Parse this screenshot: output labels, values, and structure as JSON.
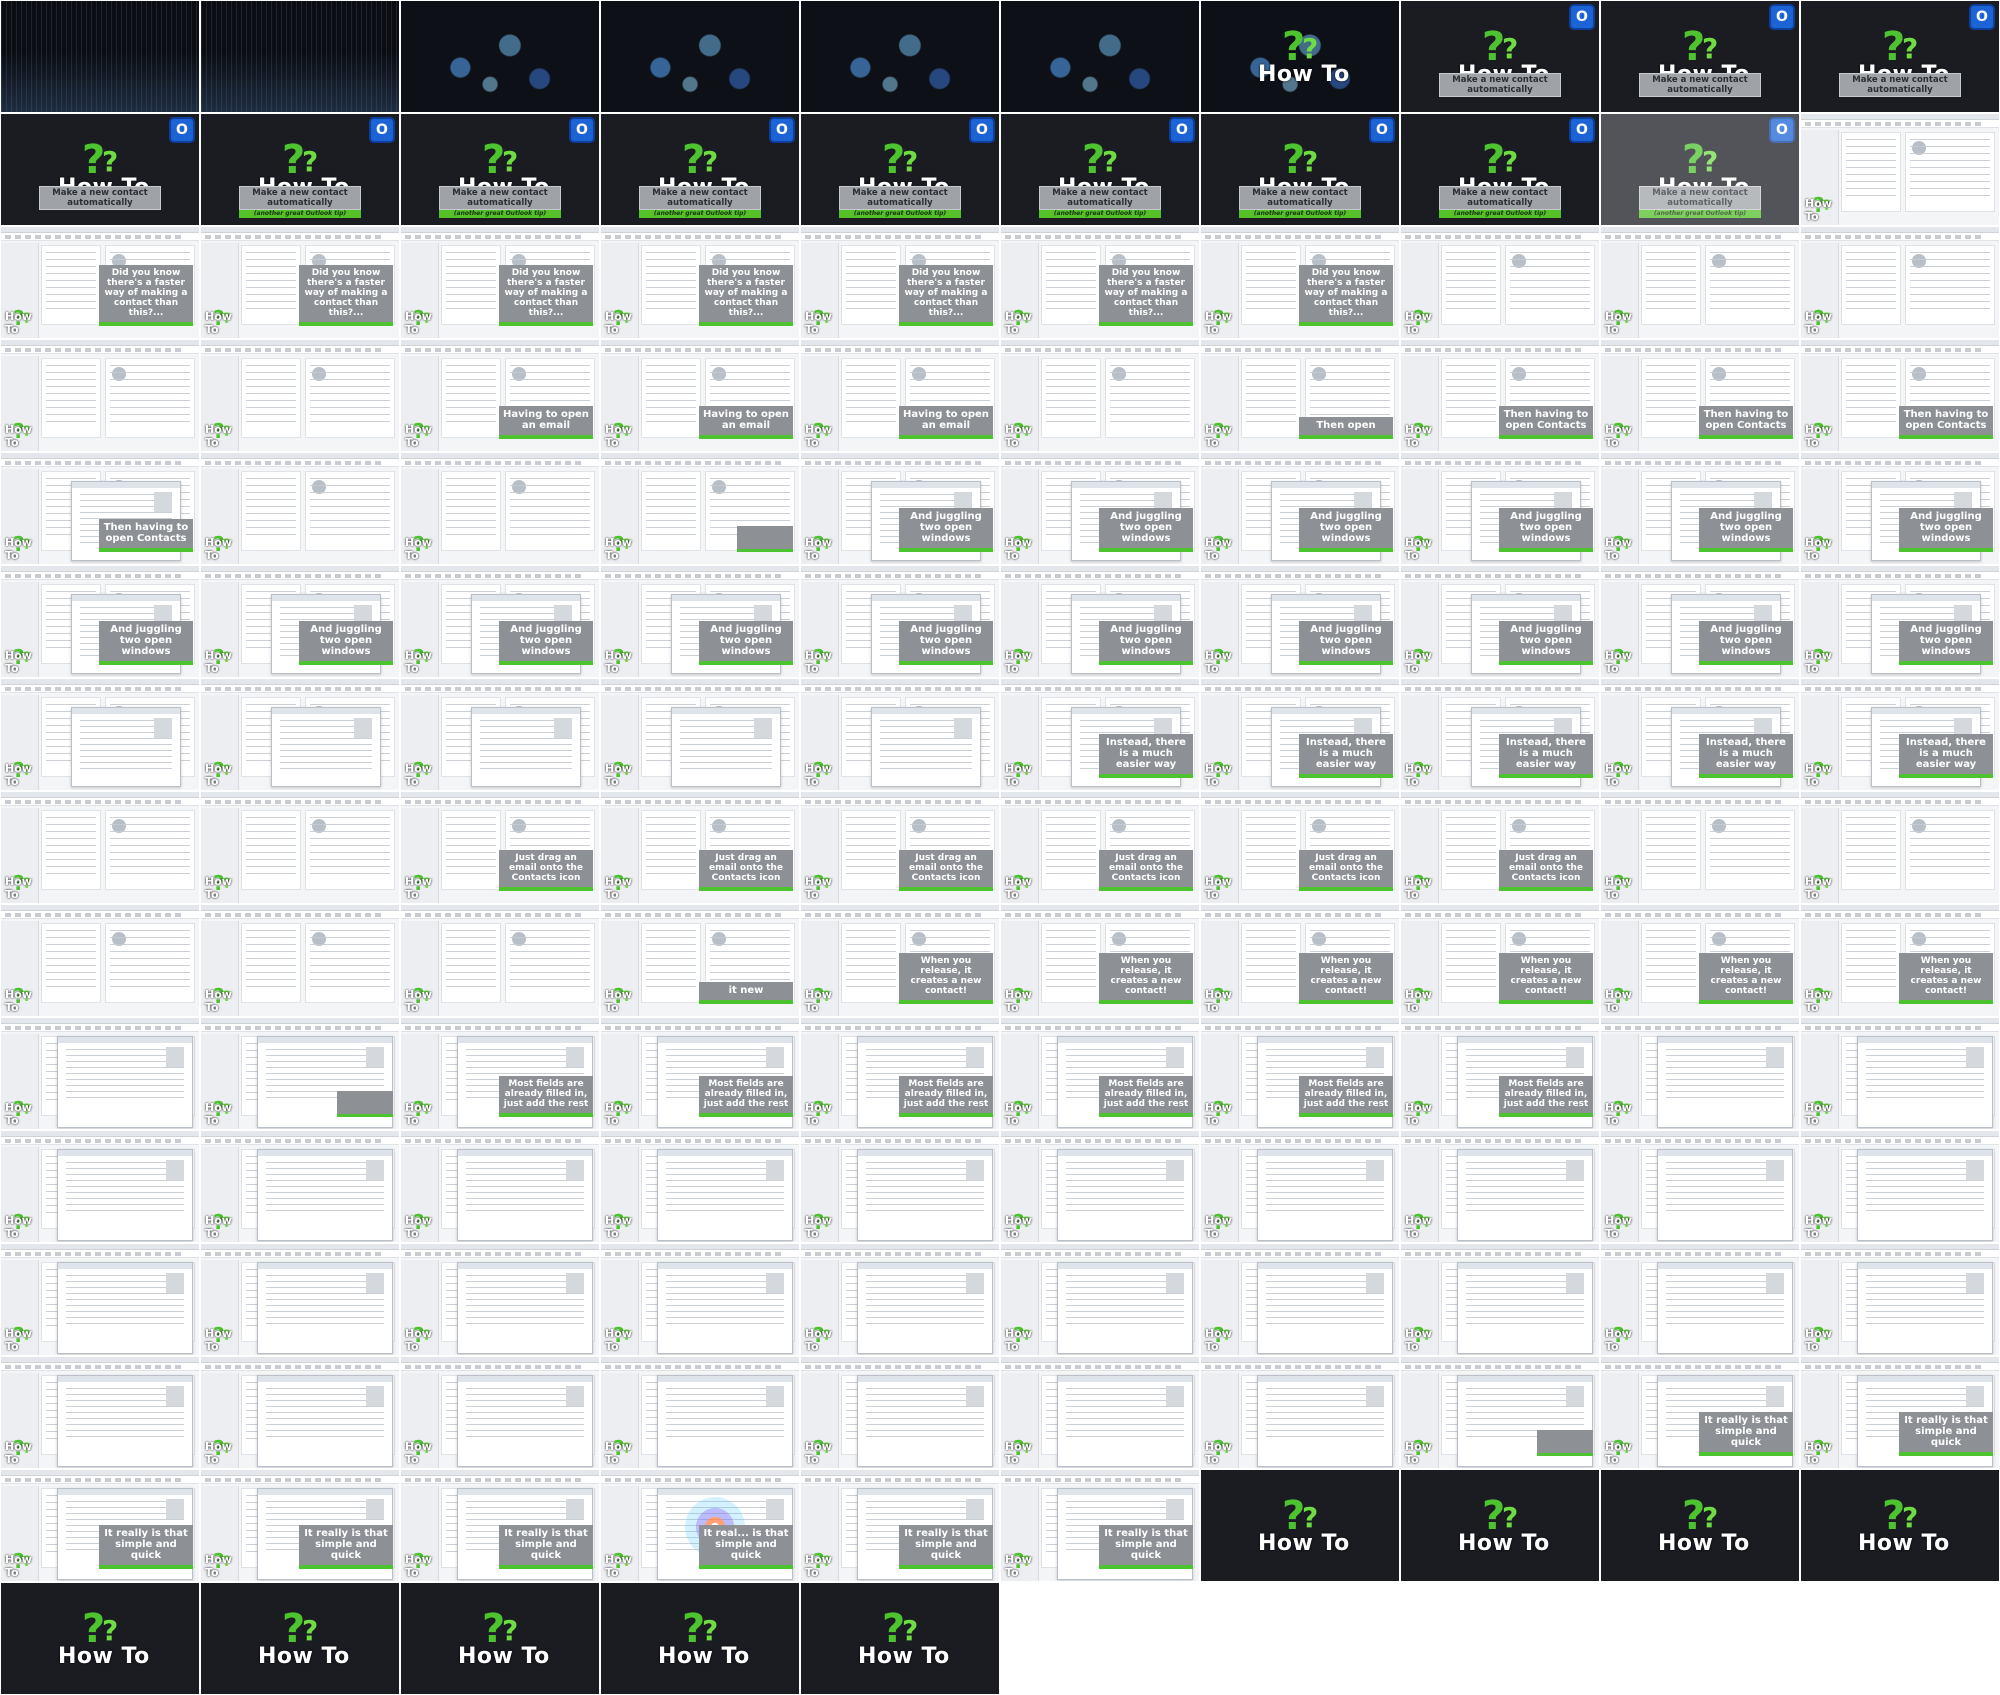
{
  "title": {
    "how_to": "How To",
    "make": "Make a new contact automatically",
    "another": "(another great Outlook tip)",
    "outlook_letter": "O"
  },
  "captions": {
    "c1": "Did you know there's a faster way of making a contact than this?...",
    "c2": "Having to open an email",
    "c3a": "Then open",
    "c3": "Then having to open Contacts",
    "c4": "And juggling two open windows",
    "c5": "Instead, there is a much easier way",
    "c6": "Just drag an email onto the Contacts icon",
    "c6b": "it new",
    "c7": "When you release, it creates a new contact!",
    "c8": "Most fields are already filled in, just add the rest",
    "c9": "It really is that simple and quick",
    "c9b": "It real... is that simple and quick"
  },
  "tiles": [
    {
      "k": "grid"
    },
    {
      "k": "grid"
    },
    {
      "k": "particles"
    },
    {
      "k": "particles"
    },
    {
      "k": "particles"
    },
    {
      "k": "particles"
    },
    {
      "k": "ht3d"
    },
    {
      "k": "title"
    },
    {
      "k": "title"
    },
    {
      "k": "title"
    },
    {
      "k": "title"
    },
    {
      "k": "title2"
    },
    {
      "k": "title2"
    },
    {
      "k": "title2"
    },
    {
      "k": "title2"
    },
    {
      "k": "title2"
    },
    {
      "k": "title2"
    },
    {
      "k": "title2"
    },
    {
      "k": "titlefade"
    },
    {
      "k": "ui",
      "v": "list"
    },
    {
      "k": "ui",
      "v": "list",
      "cap": "c1"
    },
    {
      "k": "ui",
      "v": "list",
      "cap": "c1"
    },
    {
      "k": "ui",
      "v": "list",
      "cap": "c1"
    },
    {
      "k": "ui",
      "v": "list",
      "cap": "c1"
    },
    {
      "k": "ui",
      "v": "list",
      "cap": "c1"
    },
    {
      "k": "ui",
      "v": "list",
      "cap": "c1"
    },
    {
      "k": "ui",
      "v": "list",
      "cap": "c1"
    },
    {
      "k": "ui",
      "v": "list"
    },
    {
      "k": "ui",
      "v": "list"
    },
    {
      "k": "ui",
      "v": "list"
    },
    {
      "k": "ui",
      "v": "list"
    },
    {
      "k": "ui",
      "v": "read"
    },
    {
      "k": "ui",
      "v": "read",
      "cap": "c2"
    },
    {
      "k": "ui",
      "v": "read",
      "cap": "c2"
    },
    {
      "k": "ui",
      "v": "read",
      "cap": "c2"
    },
    {
      "k": "ui",
      "v": "read"
    },
    {
      "k": "ui",
      "v": "read",
      "cap": "c3a"
    },
    {
      "k": "ui",
      "v": "read",
      "cap": "c3"
    },
    {
      "k": "ui",
      "v": "read",
      "cap": "c3"
    },
    {
      "k": "ui",
      "v": "read",
      "cap": "c3"
    },
    {
      "k": "ui",
      "v": "win",
      "cap": "c3"
    },
    {
      "k": "ui",
      "v": "read"
    },
    {
      "k": "ui",
      "v": "list"
    },
    {
      "k": "ui",
      "v": "list",
      "gray": true
    },
    {
      "k": "ui",
      "v": "win",
      "cap": "c4"
    },
    {
      "k": "ui",
      "v": "win",
      "cap": "c4"
    },
    {
      "k": "ui",
      "v": "win",
      "cap": "c4"
    },
    {
      "k": "ui",
      "v": "win",
      "cap": "c4"
    },
    {
      "k": "ui",
      "v": "win",
      "cap": "c4"
    },
    {
      "k": "ui",
      "v": "win",
      "cap": "c4"
    },
    {
      "k": "ui",
      "v": "win",
      "cap": "c4"
    },
    {
      "k": "ui",
      "v": "win",
      "cap": "c4"
    },
    {
      "k": "ui",
      "v": "win",
      "cap": "c4"
    },
    {
      "k": "ui",
      "v": "win",
      "cap": "c4"
    },
    {
      "k": "ui",
      "v": "win",
      "cap": "c4"
    },
    {
      "k": "ui",
      "v": "win",
      "cap": "c4"
    },
    {
      "k": "ui",
      "v": "win",
      "cap": "c4"
    },
    {
      "k": "ui",
      "v": "win",
      "cap": "c4"
    },
    {
      "k": "ui",
      "v": "win",
      "cap": "c4"
    },
    {
      "k": "ui",
      "v": "win",
      "cap": "c4"
    },
    {
      "k": "ui",
      "v": "win"
    },
    {
      "k": "ui",
      "v": "win"
    },
    {
      "k": "ui",
      "v": "win"
    },
    {
      "k": "ui",
      "v": "win"
    },
    {
      "k": "ui",
      "v": "win"
    },
    {
      "k": "ui",
      "v": "win",
      "cap": "c5"
    },
    {
      "k": "ui",
      "v": "win",
      "cap": "c5"
    },
    {
      "k": "ui",
      "v": "win",
      "cap": "c5"
    },
    {
      "k": "ui",
      "v": "win",
      "cap": "c5"
    },
    {
      "k": "ui",
      "v": "win",
      "cap": "c5"
    },
    {
      "k": "ui",
      "v": "list"
    },
    {
      "k": "ui",
      "v": "list"
    },
    {
      "k": "ui",
      "v": "list",
      "cap": "c6"
    },
    {
      "k": "ui",
      "v": "list",
      "cap": "c6"
    },
    {
      "k": "ui",
      "v": "list",
      "cap": "c6"
    },
    {
      "k": "ui",
      "v": "list",
      "cap": "c6"
    },
    {
      "k": "ui",
      "v": "list",
      "cap": "c6"
    },
    {
      "k": "ui",
      "v": "list",
      "cap": "c6"
    },
    {
      "k": "ui",
      "v": "list"
    },
    {
      "k": "ui",
      "v": "list"
    },
    {
      "k": "ui",
      "v": "list"
    },
    {
      "k": "ui",
      "v": "list"
    },
    {
      "k": "ui",
      "v": "list"
    },
    {
      "k": "ui",
      "v": "list",
      "cap": "c6b"
    },
    {
      "k": "ui",
      "v": "list",
      "cap": "c7"
    },
    {
      "k": "ui",
      "v": "list",
      "cap": "c7"
    },
    {
      "k": "ui",
      "v": "list",
      "cap": "c7"
    },
    {
      "k": "ui",
      "v": "list",
      "cap": "c7"
    },
    {
      "k": "ui",
      "v": "list",
      "cap": "c7"
    },
    {
      "k": "ui",
      "v": "list",
      "cap": "c7"
    },
    {
      "k": "ui",
      "v": "contact"
    },
    {
      "k": "ui",
      "v": "contact",
      "gray": true
    },
    {
      "k": "ui",
      "v": "contact",
      "cap": "c8"
    },
    {
      "k": "ui",
      "v": "contact",
      "cap": "c8"
    },
    {
      "k": "ui",
      "v": "contact",
      "cap": "c8"
    },
    {
      "k": "ui",
      "v": "contact",
      "cap": "c8"
    },
    {
      "k": "ui",
      "v": "contact",
      "cap": "c8"
    },
    {
      "k": "ui",
      "v": "contact",
      "cap": "c8"
    },
    {
      "k": "ui",
      "v": "contact"
    },
    {
      "k": "ui",
      "v": "contact"
    },
    {
      "k": "ui",
      "v": "contact"
    },
    {
      "k": "ui",
      "v": "contact"
    },
    {
      "k": "ui",
      "v": "contact"
    },
    {
      "k": "ui",
      "v": "contact"
    },
    {
      "k": "ui",
      "v": "contact"
    },
    {
      "k": "ui",
      "v": "contact"
    },
    {
      "k": "ui",
      "v": "contact"
    },
    {
      "k": "ui",
      "v": "contact"
    },
    {
      "k": "ui",
      "v": "contact"
    },
    {
      "k": "ui",
      "v": "contact"
    },
    {
      "k": "ui",
      "v": "contact"
    },
    {
      "k": "ui",
      "v": "contact"
    },
    {
      "k": "ui",
      "v": "contact"
    },
    {
      "k": "ui",
      "v": "contact"
    },
    {
      "k": "ui",
      "v": "contact"
    },
    {
      "k": "ui",
      "v": "contact"
    },
    {
      "k": "ui",
      "v": "contact"
    },
    {
      "k": "ui",
      "v": "contact"
    },
    {
      "k": "ui",
      "v": "contact"
    },
    {
      "k": "ui",
      "v": "contact"
    },
    {
      "k": "ui",
      "v": "contact"
    },
    {
      "k": "ui",
      "v": "contact"
    },
    {
      "k": "ui",
      "v": "contact"
    },
    {
      "k": "ui",
      "v": "contact"
    },
    {
      "k": "ui",
      "v": "contact"
    },
    {
      "k": "ui",
      "v": "contact"
    },
    {
      "k": "ui",
      "v": "contact"
    },
    {
      "k": "ui",
      "v": "contact",
      "gray": true
    },
    {
      "k": "ui",
      "v": "contact",
      "cap": "c9"
    },
    {
      "k": "ui",
      "v": "contact",
      "cap": "c9"
    },
    {
      "k": "ui",
      "v": "contact",
      "cap": "c9"
    },
    {
      "k": "ui",
      "v": "contact",
      "cap": "c9"
    },
    {
      "k": "ui",
      "v": "contact",
      "cap": "c9"
    },
    {
      "k": "ui",
      "v": "contact",
      "cap": "c9b",
      "burst": true
    },
    {
      "k": "ui",
      "v": "contact",
      "cap": "c9"
    },
    {
      "k": "ui",
      "v": "contact",
      "cap": "c9"
    },
    {
      "k": "endcard"
    },
    {
      "k": "endcard"
    },
    {
      "k": "endcard"
    },
    {
      "k": "endcard"
    },
    {
      "k": "endcard"
    },
    {
      "k": "endcard"
    },
    {
      "k": "endcard"
    },
    {
      "k": "endcard"
    },
    {
      "k": "endcard"
    },
    {
      "k": "blank"
    },
    {
      "k": "blank"
    },
    {
      "k": "blank"
    },
    {
      "k": "blank"
    },
    {
      "k": "blank"
    }
  ]
}
